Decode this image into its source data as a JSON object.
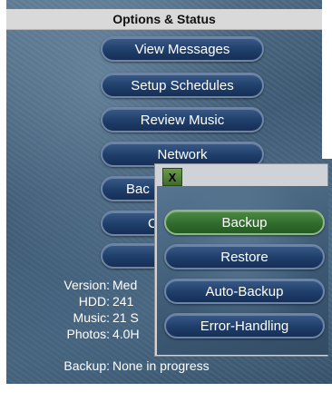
{
  "header": {
    "title": "Options & Status"
  },
  "menu": {
    "items": [
      {
        "label": "View Messages"
      },
      {
        "label": "Setup Schedules"
      },
      {
        "label": "Review Music"
      },
      {
        "label": "Network"
      },
      {
        "label": "Bac"
      },
      {
        "label": "C"
      },
      {
        "label": ""
      }
    ]
  },
  "status": {
    "version": {
      "label": "Version:",
      "value": "Med"
    },
    "hdd": {
      "label": "HDD:",
      "value": "241"
    },
    "music": {
      "label": "Music:",
      "value": "21 S"
    },
    "photos": {
      "label": "Photos:",
      "value": "4.0H"
    },
    "backup": {
      "label": "Backup:",
      "value": "None in progress"
    }
  },
  "dialog": {
    "close_label": "X",
    "options": [
      {
        "label": "Backup",
        "selected": true
      },
      {
        "label": "Restore",
        "selected": false
      },
      {
        "label": "Auto-Backup",
        "selected": false
      },
      {
        "label": "Error-Handling",
        "selected": false
      }
    ]
  },
  "colors": {
    "pill_fill": "#1f3e6b",
    "pill_border": "#6d86a8",
    "selected_fill": "#2f6a2c",
    "header_bg": "#d9d9d9"
  }
}
